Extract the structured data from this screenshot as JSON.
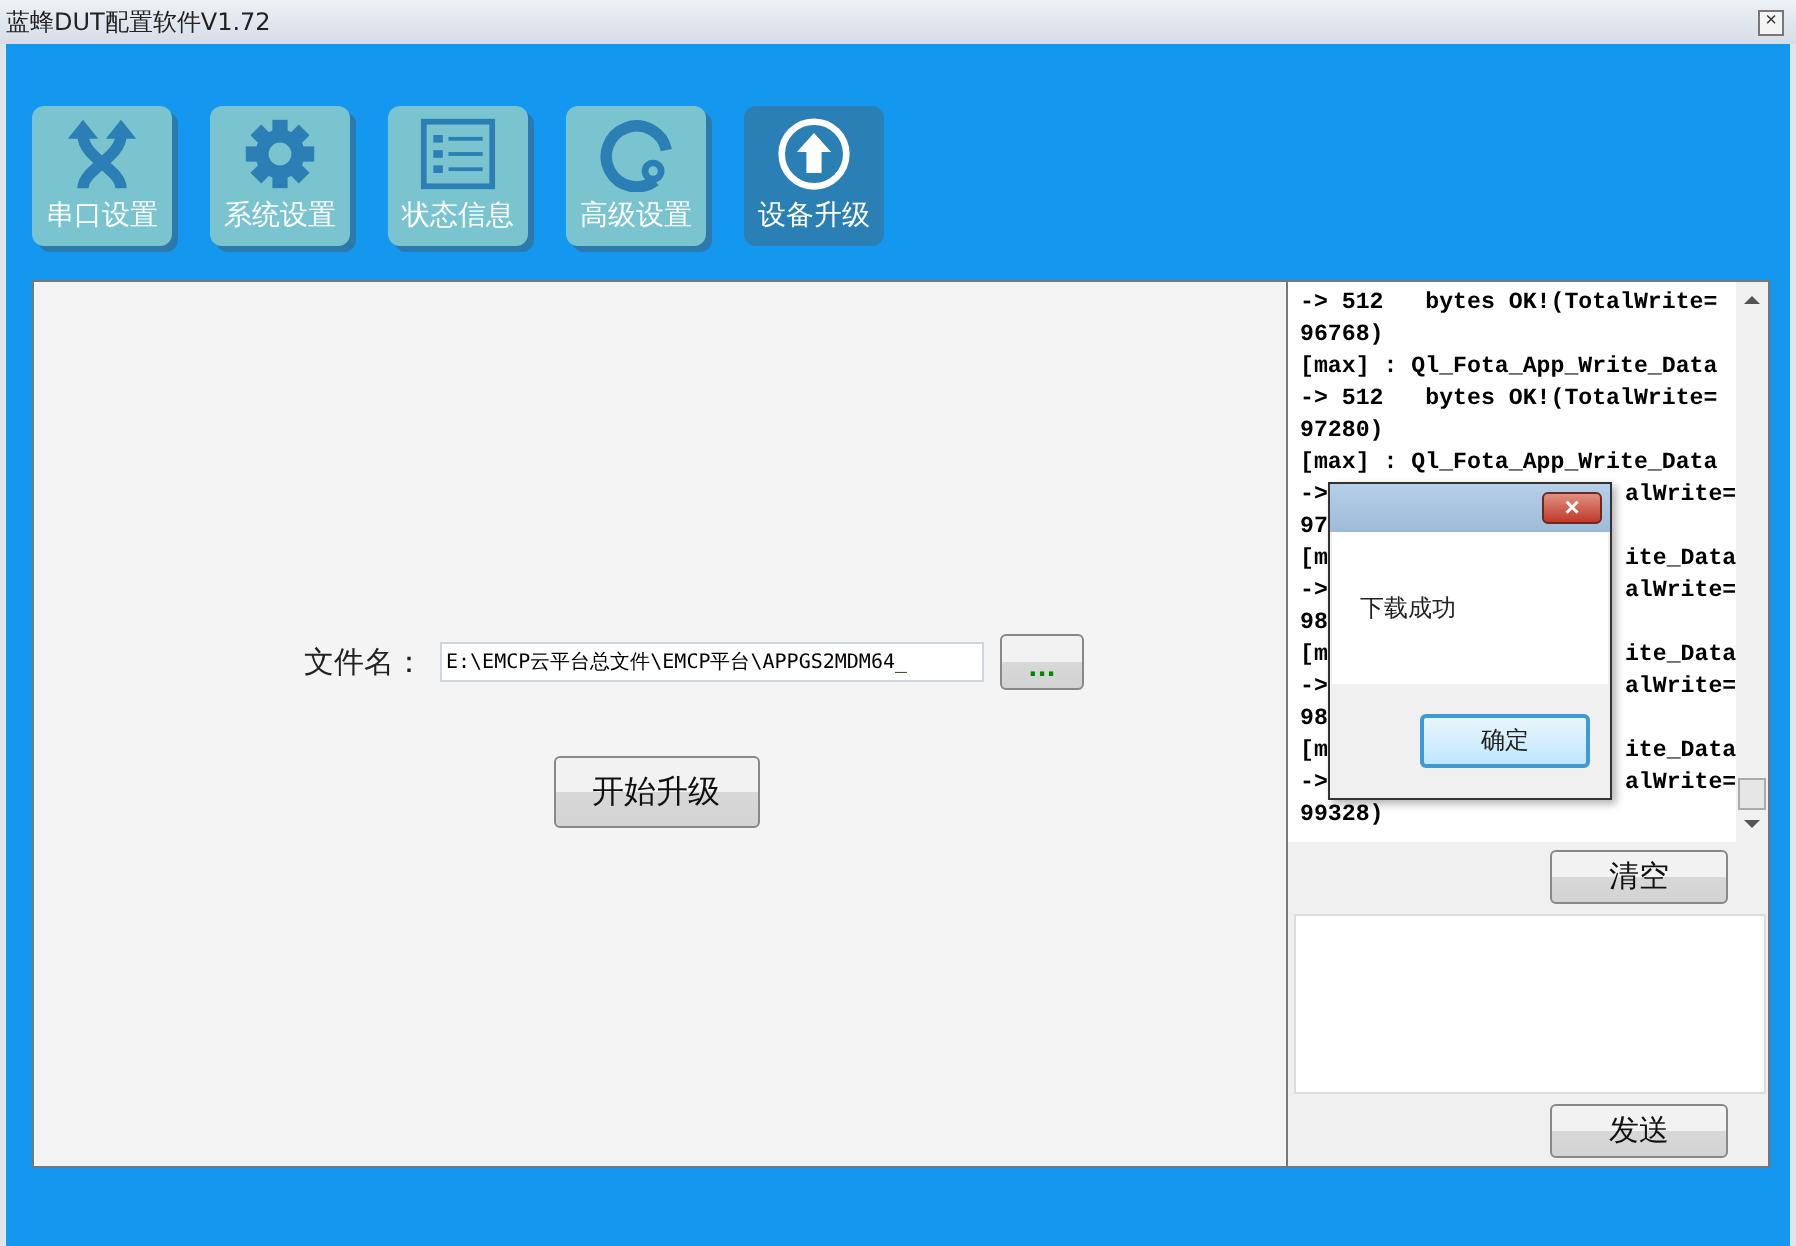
{
  "window": {
    "title": "蓝蜂DUT配置软件V1.72",
    "close": "×"
  },
  "tabs": [
    {
      "label": "串口设置",
      "kind": "arrows",
      "selected": false
    },
    {
      "label": "系统设置",
      "kind": "gear",
      "selected": false
    },
    {
      "label": "状态信息",
      "kind": "list",
      "selected": false
    },
    {
      "label": "高级设置",
      "kind": "gauge",
      "selected": false
    },
    {
      "label": "设备升级",
      "kind": "upload",
      "selected": true
    }
  ],
  "upgrade": {
    "file_label": "文件名：",
    "file_value": "E:\\EMCP云平台总文件\\EMCP平台\\APPGS2MDM64_",
    "browse_button": "...",
    "start_button": "开始升级"
  },
  "log": {
    "lines": [
      {
        "text": "-> 512   bytes OK!(TotalWrite="
      },
      {
        "text": "96768)"
      },
      {
        "text": "[max] : Ql_Fota_App_Write_Data"
      },
      {
        "text": "-> 512   bytes OK!(TotalWrite="
      },
      {
        "text": "97280)"
      },
      {
        "text": "[max] : Ql_Fota_App_Write_Data"
      },
      {
        "text": "->",
        "tail": "alWrite="
      },
      {
        "text": "97"
      },
      {
        "text": "[m",
        "tail": "ite_Data"
      },
      {
        "text": "->",
        "tail": "alWrite="
      },
      {
        "text": "98"
      },
      {
        "text": "[m",
        "tail": "ite_Data"
      },
      {
        "text": "->",
        "tail": "alWrite="
      },
      {
        "text": "98"
      },
      {
        "text": "[m",
        "tail": "ite_Data"
      },
      {
        "text": "->",
        "tail": "alWrite="
      },
      {
        "text": "99328)"
      }
    ],
    "clear_button": "清空",
    "send_button": "发送"
  },
  "dialog": {
    "message": "下载成功",
    "ok_button": "确定",
    "close": "×"
  }
}
